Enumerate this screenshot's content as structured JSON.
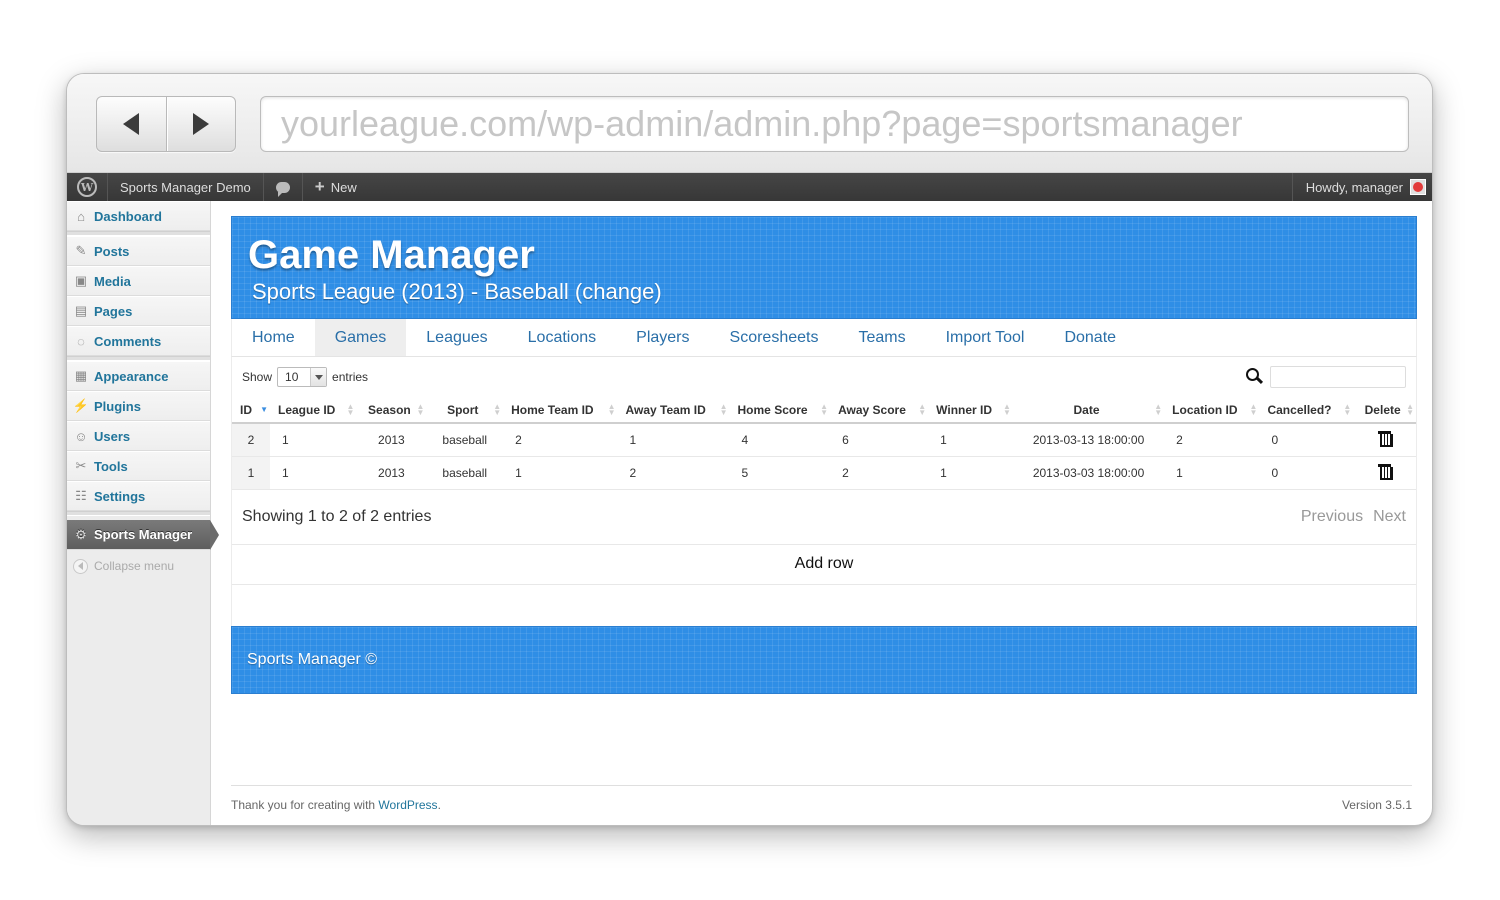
{
  "browser": {
    "url": "yourleague.com/wp-admin/admin.php?page=sportsmanager"
  },
  "adminbar": {
    "site_name": "Sports Manager Demo",
    "new_label": "New",
    "howdy": "Howdy, manager"
  },
  "sidebar": {
    "items": [
      {
        "label": "Dashboard",
        "icon": "home-icon"
      },
      {
        "label": "Posts",
        "icon": "pin-icon"
      },
      {
        "label": "Media",
        "icon": "media-icon"
      },
      {
        "label": "Pages",
        "icon": "pages-icon"
      },
      {
        "label": "Comments",
        "icon": "comment-icon"
      },
      {
        "label": "Appearance",
        "icon": "appearance-icon"
      },
      {
        "label": "Plugins",
        "icon": "plugin-icon"
      },
      {
        "label": "Users",
        "icon": "users-icon"
      },
      {
        "label": "Tools",
        "icon": "tools-icon"
      },
      {
        "label": "Settings",
        "icon": "settings-icon"
      },
      {
        "label": "Sports Manager",
        "icon": "gear-icon"
      }
    ],
    "collapse_label": "Collapse menu"
  },
  "header": {
    "title": "Game Manager",
    "subtitle": "Sports League (2013) - Baseball",
    "change_label": "(change)"
  },
  "tabs": [
    "Home",
    "Games",
    "Leagues",
    "Locations",
    "Players",
    "Scoresheets",
    "Teams",
    "Import Tool",
    "Donate"
  ],
  "active_tab": "Games",
  "table_controls": {
    "show_label": "Show",
    "page_size": "10",
    "entries_label": "entries"
  },
  "table": {
    "columns": [
      "ID",
      "League ID",
      "Season",
      "Sport",
      "Home Team ID",
      "Away Team ID",
      "Home Score",
      "Away Score",
      "Winner ID",
      "Date",
      "Location ID",
      "Cancelled?",
      "Delete"
    ],
    "rows": [
      [
        "2",
        "1",
        "2013",
        "baseball",
        "2",
        "1",
        "4",
        "6",
        "1",
        "2013-03-13 18:00:00",
        "2",
        "0"
      ],
      [
        "1",
        "1",
        "2013",
        "baseball",
        "1",
        "2",
        "5",
        "2",
        "1",
        "2013-03-03 18:00:00",
        "1",
        "0"
      ]
    ]
  },
  "pagination": {
    "info": "Showing 1 to 2 of 2 entries",
    "previous": "Previous",
    "next": "Next"
  },
  "add_row_label": "Add row",
  "plugin_footer": "Sports Manager ©",
  "wp_footer": {
    "thanks_prefix": "Thank you for creating with",
    "thanks_link": "WordPress",
    "thanks_suffix": ".",
    "version": "Version 3.5.1"
  },
  "colors": {
    "header_blue": "#2f8ee6",
    "link_blue": "#21759b",
    "adminbar_dark": "#464646"
  }
}
